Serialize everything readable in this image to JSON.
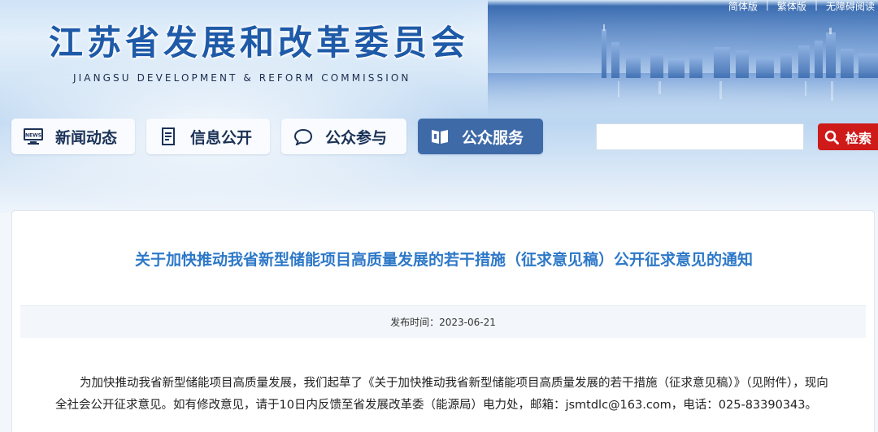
{
  "header": {
    "site_title": "江苏省发展和改革委员会",
    "site_subtitle": "JIANGSU DEVELOPMENT & REFORM COMMISSION",
    "top_links": [
      "简体版",
      "繁体版",
      "无障碍阅读"
    ],
    "top_link_separator": "|"
  },
  "nav": {
    "items": [
      {
        "label": "新闻动态",
        "icon": "news-icon"
      },
      {
        "label": "信息公开",
        "icon": "document-icon"
      },
      {
        "label": "公众参与",
        "icon": "chat-bubble-icon"
      },
      {
        "label": "公众服务",
        "icon": "service-icon"
      }
    ],
    "active_index": 3
  },
  "search": {
    "placeholder": "",
    "button_label": "检索"
  },
  "article": {
    "title": "关于加快推动我省新型储能项目高质量发展的若干措施（征求意见稿）公开征求意见的通知",
    "publish_time": "发布时间：2023-06-21",
    "body": "为加快推动我省新型储能项目高质量发展，我们起草了《关于加快推动我省新型储能项目高质量发展的若干措施（征求意见稿）》（见附件），现向全社会公开征求意见。如有修改意见，请于10日内反馈至省发展改革委（能源局）电力处，邮箱：jsmtdlc@163.com，电话：025-83390343。"
  },
  "colors": {
    "title_blue": "#1e5aa8",
    "article_title_blue": "#2d78c8",
    "active_tab": "#3e6aa8",
    "search_red": "#cf1a1a"
  }
}
